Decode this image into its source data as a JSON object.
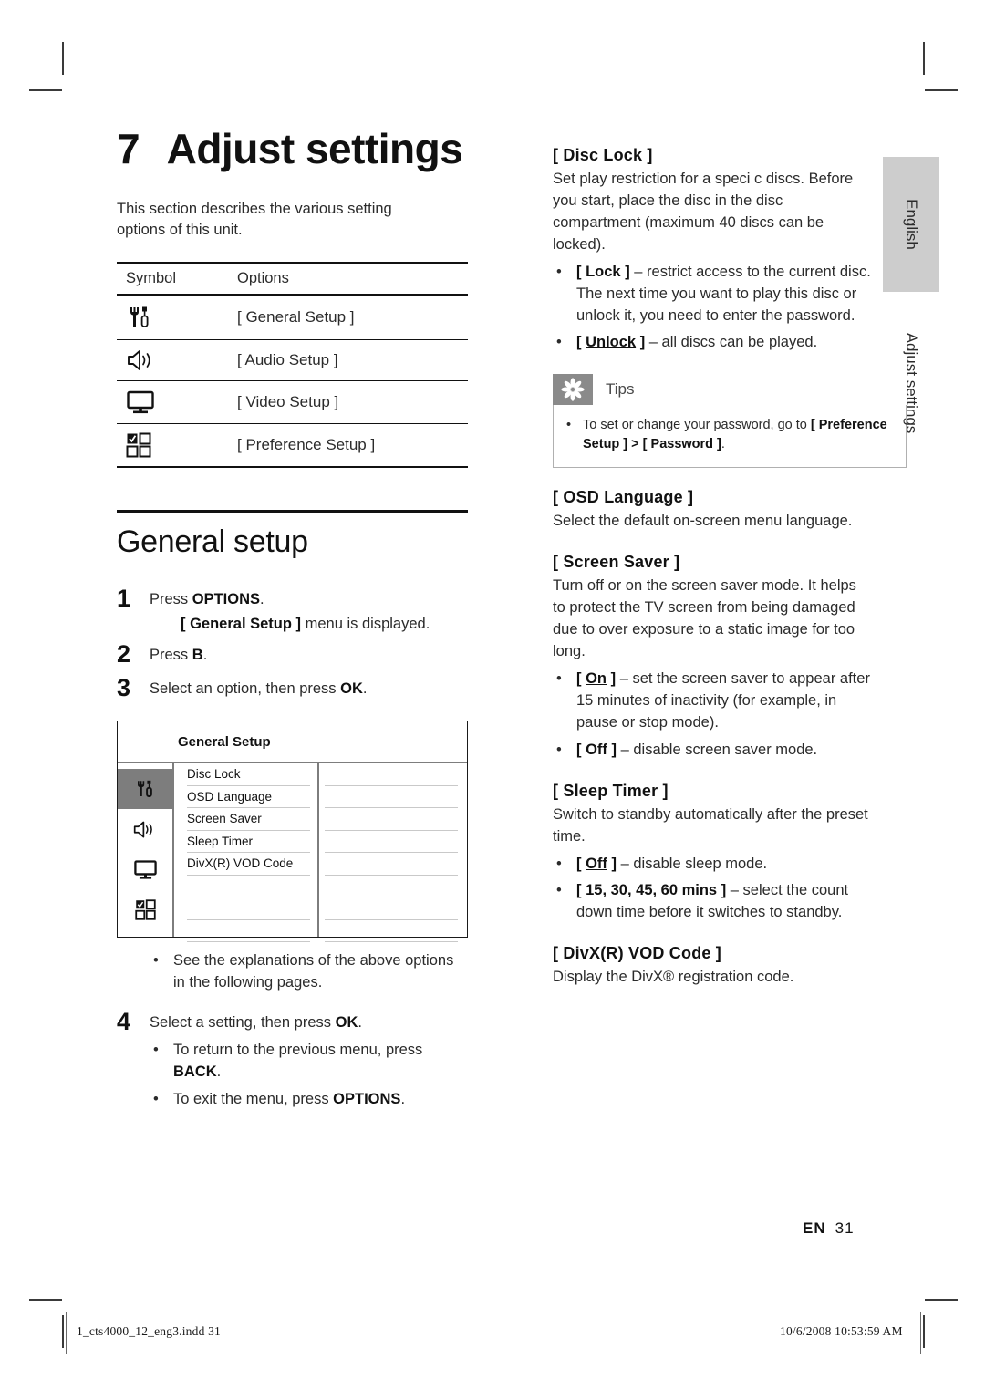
{
  "chapter": {
    "number": "7",
    "title": "Adjust settings",
    "intro": "This section describes the various setting options of this unit."
  },
  "symbol_table": {
    "headers": [
      "Symbol",
      "Options"
    ],
    "rows": [
      {
        "icon": "tools-icon",
        "option": "[ General Setup ]"
      },
      {
        "icon": "speaker-icon",
        "option": "[ Audio Setup ]"
      },
      {
        "icon": "monitor-icon",
        "option": "[ Video Setup ]"
      },
      {
        "icon": "grid-check-icon",
        "option": "[ Preference Setup ]"
      }
    ]
  },
  "general_setup": {
    "heading": "General setup",
    "steps": [
      {
        "num": "1",
        "text_prefix": "Press ",
        "text_bold": "OPTIONS",
        "text_suffix": ".",
        "sub_bracket": "[ General Setup ]",
        "sub_rest": " menu is displayed."
      },
      {
        "num": "2",
        "text_prefix": "Press ",
        "text_bold": "B",
        "text_suffix": "."
      },
      {
        "num": "3",
        "text_prefix": "Select an option, then press ",
        "text_bold": "OK",
        "text_suffix": "."
      }
    ],
    "step3_bullet": "See the explanations of the above options in the following pages.",
    "step4": {
      "num": "4",
      "text_prefix": "Select a setting, then press ",
      "text_bold": "OK",
      "text_suffix": ".",
      "bullets": [
        {
          "prefix": "To return to the previous menu, press ",
          "bold": "BACK",
          "suffix": "."
        },
        {
          "prefix": "To exit the menu, press ",
          "bold": "OPTIONS",
          "suffix": "."
        }
      ]
    }
  },
  "osd_menu": {
    "title": "General Setup",
    "icons": [
      "tools-icon",
      "speaker-icon",
      "monitor-icon",
      "grid-check-icon"
    ],
    "selected_icon_index": 0,
    "items": [
      "Disc Lock",
      "OSD Language",
      "Screen Saver",
      "Sleep Timer",
      "DivX(R) VOD Code",
      "",
      "",
      ""
    ]
  },
  "right_column": {
    "disc_lock": {
      "heading": "[ Disc Lock ]",
      "paragraph": "Set play restriction for a speci c discs. Before you start, place the disc in the disc compartment (maximum 40 discs can be locked).",
      "bullets": [
        {
          "bracket_open": "[ ",
          "term": "Lock",
          "underline": false,
          "bracket_close": " ]",
          "rest": " – restrict access to the current disc. The next time you want to play this disc or unlock it, you need to enter the password."
        },
        {
          "bracket_open": "[ ",
          "term": "Unlock",
          "underline": true,
          "bracket_close": " ]",
          "rest": " – all discs can be played."
        }
      ]
    },
    "tips": {
      "label": "Tips",
      "icon": "asterisk-icon",
      "bullet_prefix": "To set or change your password, go to ",
      "bullet_bold_1": "[ Preference Setup ]",
      "bullet_mid": " > ",
      "bullet_bold_2": "[ Password ]",
      "bullet_suffix": "."
    },
    "osd_language": {
      "heading": "[ OSD Language ]",
      "paragraph": "Select the default on-screen menu language."
    },
    "screen_saver": {
      "heading": "[ Screen Saver ]",
      "paragraph": "Turn off or on the screen saver mode. It helps to protect the TV screen from being damaged due to over exposure to a static image for too long.",
      "bullets": [
        {
          "bracket_open": "[ ",
          "term": "On",
          "underline": true,
          "bracket_close": " ]",
          "rest": " – set the screen saver to appear after 15 minutes of inactivity (for example, in pause or stop mode)."
        },
        {
          "bracket_open": "[ ",
          "term": "Off",
          "underline": false,
          "bracket_close": " ]",
          "rest": " – disable screen saver mode."
        }
      ]
    },
    "sleep_timer": {
      "heading": "[ Sleep Timer ]",
      "paragraph": "Switch to standby automatically after the preset time.",
      "bullets": [
        {
          "bracket_open": "[ ",
          "term": "Off",
          "underline": true,
          "bracket_close": " ]",
          "rest": " – disable sleep mode."
        },
        {
          "bracket_open": "[ ",
          "term": "15, 30, 45, 60 mins",
          "underline": false,
          "bracket_close": " ]",
          "rest": " – select the count down time before it switches to standby."
        }
      ]
    },
    "divx": {
      "heading": "[ DivX(R) VOD Code ]",
      "paragraph": "Display the DivX® registration code."
    }
  },
  "side_tabs": {
    "language": "English",
    "section": "Adjust settings"
  },
  "page_footer": {
    "locale_code": "EN",
    "page_number": "31",
    "file_name": "1_cts4000_12_eng3.indd   31",
    "timestamp": "10/6/2008   10:53:59 AM"
  },
  "colors": {
    "text": "#2b2b2b",
    "heading": "#111111",
    "tab_gray": "#cdcdcd",
    "tips_gray": "#8a8a8a",
    "menu_gray": "#7d7d7d"
  }
}
